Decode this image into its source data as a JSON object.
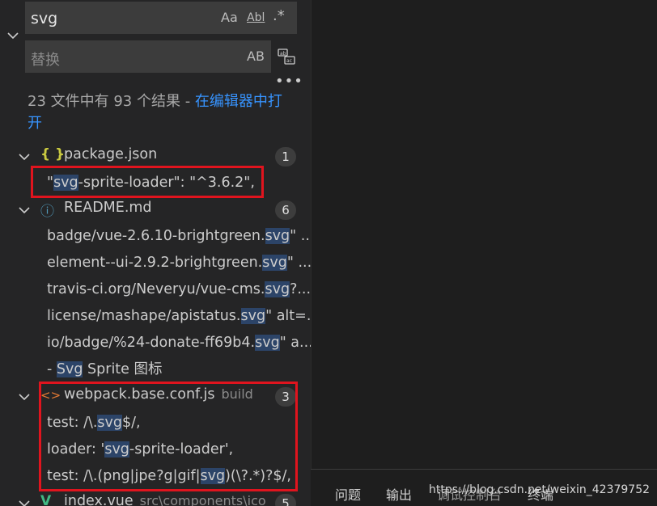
{
  "search": {
    "query": "svg",
    "opt_case": "Aa",
    "opt_word": "Abl",
    "opt_regex": ".*",
    "replace_placeholder": "替换",
    "opt_preserve_case": "AB"
  },
  "summary": {
    "text": "23 文件中有 93 个结果 - ",
    "link": "在编辑器中打开"
  },
  "files": [
    {
      "name": "package.json",
      "path": "",
      "count": "1",
      "icon": "{ }"
    },
    {
      "name": "README.md",
      "path": "",
      "count": "6",
      "icon": "ⓘ"
    },
    {
      "name": "webpack.base.conf.js",
      "path": "build",
      "count": "3",
      "icon": "<>"
    },
    {
      "name": "index.vue",
      "path": "src\\components\\ico",
      "count": "5",
      "icon": "V"
    }
  ],
  "matches": {
    "pkg": [
      {
        "pre": "\"",
        "hl": "svg",
        "post": "-sprite-loader\": \"^3.6.2\","
      }
    ],
    "readme": [
      {
        "pre": "badge/vue-2.6.10-brightgreen.",
        "hl": "svg",
        "post": "\" ..."
      },
      {
        "pre": "element--ui-2.9.2-brightgreen.",
        "hl": "svg",
        "post": "\" ..."
      },
      {
        "pre": "travis-ci.org/Neveryu/vue-cms.",
        "hl": "svg",
        "post": "?..."
      },
      {
        "pre": "license/mashape/apistatus.",
        "hl": "svg",
        "post": "\" alt=..."
      },
      {
        "pre": "io/badge/%24-donate-ff69b4.",
        "hl": "svg",
        "post": "\" a..."
      },
      {
        "pre": "- ",
        "hl": "Svg",
        "post": " Sprite 图标"
      }
    ],
    "webpack": [
      {
        "pre": "test: /\\.",
        "hl": "svg",
        "post": "$/,"
      },
      {
        "pre": "loader: '",
        "hl": "svg",
        "post": "-sprite-loader',"
      },
      {
        "pre": "test: /\\.(png|jpe?g|gif|",
        "hl": "svg",
        "post": ")(\\?.*)?$/,"
      }
    ]
  },
  "panel": {
    "tab_problems": "问题",
    "tab_output": "输出",
    "tab_debug": "调试控制台",
    "tab_terminal": "终端"
  },
  "watermark": "https://blog.csdn.net/weixin_42379752",
  "colors": {
    "sidebar_bg": "#252526",
    "editor_bg": "#1e1e1e",
    "input_bg": "#3c3c3c",
    "link": "#3794ff",
    "highlight": "#2c4468",
    "annotation_red": "#e0141e",
    "json_icon": "#cbcb41",
    "info_icon": "#519aba",
    "js_icon": "#e37933",
    "vue_icon": "#41b883"
  }
}
